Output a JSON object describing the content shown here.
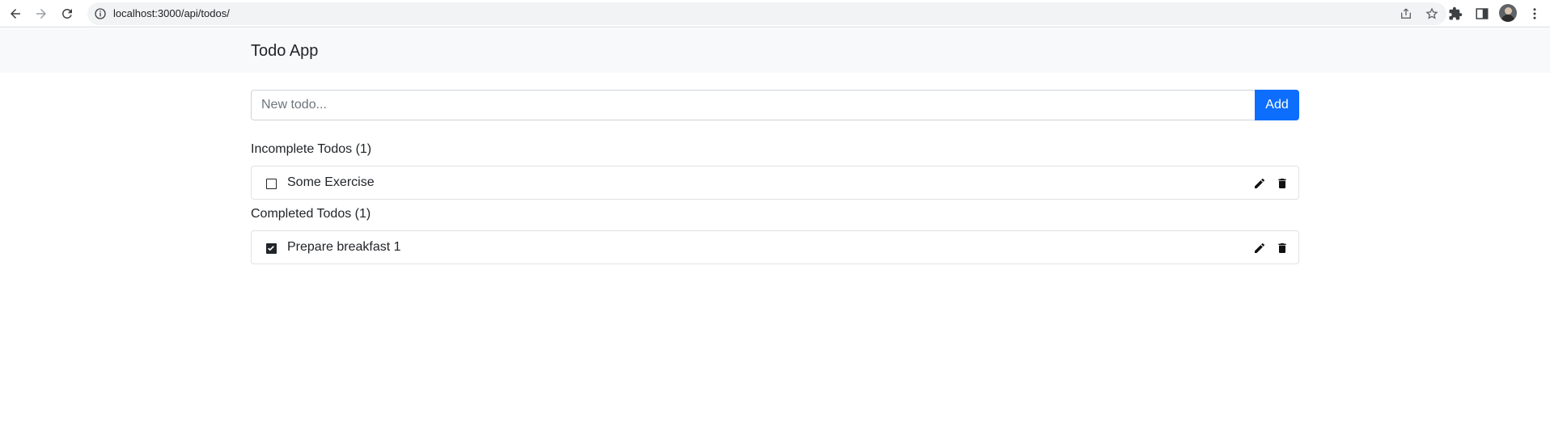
{
  "browser": {
    "url": "localhost:3000/api/todos/"
  },
  "app": {
    "brand": "Todo App"
  },
  "new_todo": {
    "placeholder": "New todo...",
    "value": "",
    "add_label": "Add"
  },
  "incomplete": {
    "title": "Incomplete Todos (1)",
    "items": [
      {
        "text": "Some Exercise",
        "done": false
      }
    ]
  },
  "completed": {
    "title": "Completed Todos (1)",
    "items": [
      {
        "text": "Prepare breakfast 1",
        "done": true
      }
    ]
  },
  "colors": {
    "primary": "#0d6efd",
    "navbar_bg": "#f8f9fa",
    "border": "#dee2e6"
  }
}
